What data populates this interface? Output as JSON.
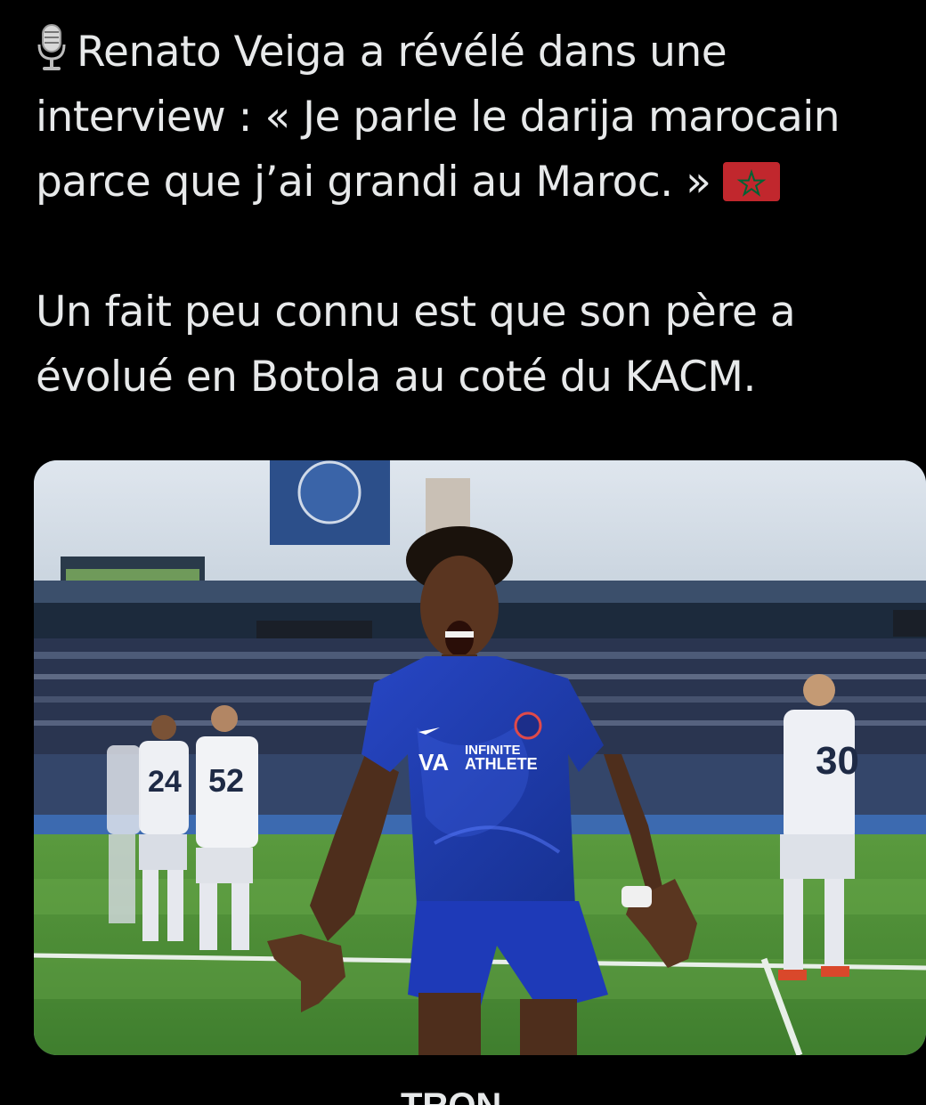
{
  "post": {
    "line1": "Renato Veiga a révélé dans une",
    "line2": "interview : « Je parle le darija marocain",
    "line3": "parce que j’ai grandi au Maroc. »",
    "line4": "Un fait peu connu est que son père a",
    "line5": "évolué en Botola au coté du KACM.",
    "leading_icon": "microphone-icon",
    "trailing_icon": "morocco-flag-icon"
  },
  "photo": {
    "sponsor_top": "INFINITE",
    "sponsor_bottom": "ATHLETE",
    "number_left_1": "24",
    "number_left_2": "52",
    "number_right": "30"
  },
  "footer": {
    "partial_text": "TRON"
  },
  "colors": {
    "background": "#000000",
    "text": "#e7e9ea",
    "chelsea_blue": "#1f3fb5",
    "pitch_green": "#4f8f3a",
    "flag_red": "#c1272d",
    "flag_green": "#006233"
  }
}
